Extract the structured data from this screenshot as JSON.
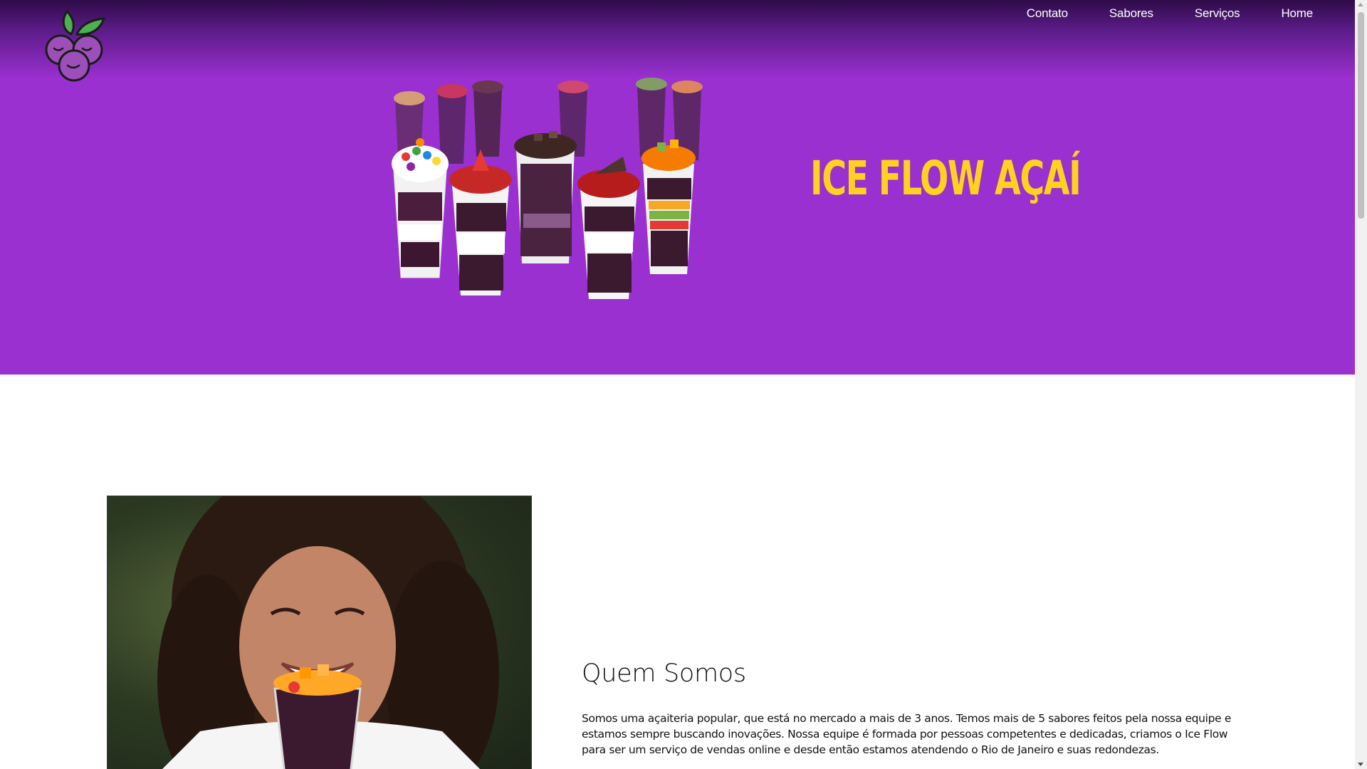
{
  "nav": {
    "items": [
      {
        "label": "Contato"
      },
      {
        "label": "Sabores"
      },
      {
        "label": "Serviços"
      },
      {
        "label": "Home"
      }
    ]
  },
  "hero": {
    "title": "ICE FLOW AÇAÍ",
    "title_color": "#ffd21f",
    "background": "#9a30cf",
    "image": "acai-cups-image"
  },
  "logo": {
    "icon": "acai-berries-logo",
    "leaf_color": "#4caf50",
    "berry_color": "#9c4fb8"
  },
  "about": {
    "heading": "Quem Somos",
    "text": "Somos uma açaiteria popular, que está no mercado a mais de 3 anos. Temos mais de 5 sabores feitos pela nossa equipe e estamos sempre buscando inovações. Nossa equipe é formada por pessoas competentes e dedicadas, criamos o Ice Flow para ser um serviço de vendas online e desde então estamos atendendo o Rio de Janeiro e suas redondezas.",
    "image": "woman-eating-acai-photo"
  }
}
